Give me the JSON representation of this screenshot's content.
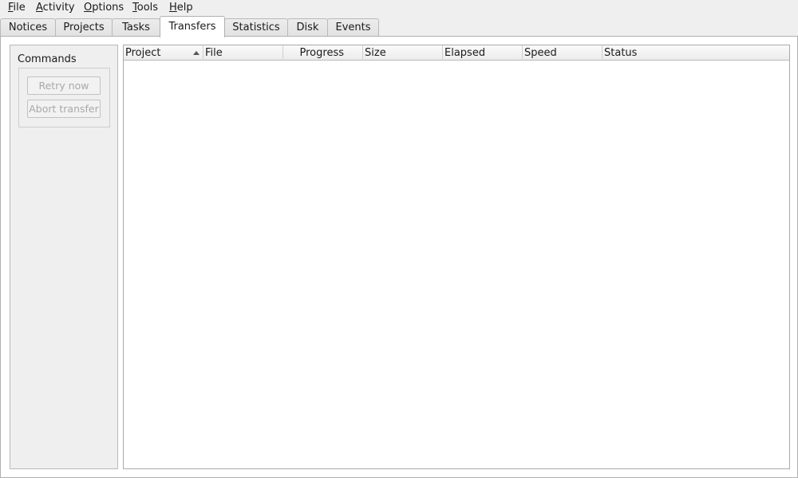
{
  "menubar": {
    "items": [
      {
        "mnemonic": "F",
        "rest": "ile"
      },
      {
        "mnemonic": "A",
        "rest": "ctivity"
      },
      {
        "mnemonic": "O",
        "rest": "ptions"
      },
      {
        "mnemonic": "T",
        "rest": "ools"
      },
      {
        "mnemonic": "H",
        "rest": "elp"
      }
    ]
  },
  "tabs": [
    {
      "label": "Notices"
    },
    {
      "label": "Projects"
    },
    {
      "label": "Tasks"
    },
    {
      "label": "Transfers",
      "active": true
    },
    {
      "label": "Statistics"
    },
    {
      "label": "Disk"
    },
    {
      "label": "Events"
    }
  ],
  "commands": {
    "title": "Commands",
    "retry_label": "Retry now",
    "abort_label": "Abort transfer"
  },
  "transfers_table": {
    "columns": [
      {
        "label": "Project",
        "sorted": "ascending"
      },
      {
        "label": "File"
      },
      {
        "label": "Progress"
      },
      {
        "label": "Size"
      },
      {
        "label": "Elapsed"
      },
      {
        "label": "Speed"
      },
      {
        "label": "Status"
      }
    ],
    "rows": []
  }
}
